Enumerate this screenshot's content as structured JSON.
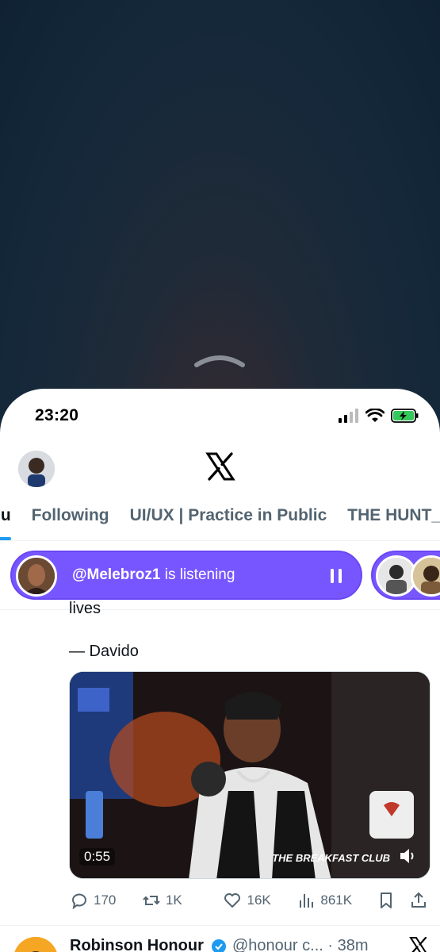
{
  "status_bar": {
    "time": "23:20"
  },
  "tabs": [
    {
      "label": "ou",
      "active": true
    },
    {
      "label": "Following",
      "active": false
    },
    {
      "label": "UI/UX | Practice in Public",
      "active": false
    },
    {
      "label": "THE HUNT_",
      "active": false
    }
  ],
  "listening": {
    "handle": "@Melebroz1",
    "text": "is listening"
  },
  "tweet": {
    "cut_text": "lives",
    "quote_author": "— Davido",
    "media": {
      "duration": "0:55",
      "watermark": "THE BREAKFAST CLUB"
    },
    "actions": {
      "replies": "170",
      "reposts": "1K",
      "likes": "16K",
      "views": "861K"
    }
  },
  "next_tweet": {
    "name": "Robinson Honour",
    "handle": "@honour c...",
    "time": "· 38m"
  },
  "colors": {
    "accent": "#1d9bf0",
    "spaces_purple": "#7856ff",
    "text_primary": "#0f1419",
    "text_secondary": "#536471"
  }
}
